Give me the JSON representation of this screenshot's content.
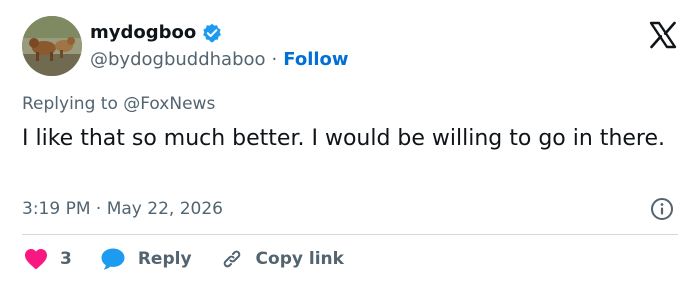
{
  "author": {
    "display_name": "mydogboo",
    "handle": "@bydogbuddhaboo",
    "separator": "·",
    "follow_label": "Follow",
    "verified": true
  },
  "reply_context": {
    "prefix": "Replying to",
    "mention": "@FoxNews"
  },
  "tweet": {
    "text": "I like that so much better. I would be willing to go in there."
  },
  "meta": {
    "time": "3:19 PM",
    "separator": "·",
    "date": "May 22, 2026"
  },
  "actions": {
    "like_count": "3",
    "reply_label": "Reply",
    "copy_link_label": "Copy link"
  },
  "icons": {
    "verified": "verified-badge-icon",
    "logo": "x-logo-icon",
    "info": "info-icon",
    "like": "heart-icon",
    "reply": "speech-bubble-icon",
    "copy": "link-icon"
  },
  "colors": {
    "accent": "#1d9bf0",
    "follow": "#006fd6",
    "like": "#f91880",
    "secondary_text": "#536471",
    "divider": "#cfd9de"
  }
}
